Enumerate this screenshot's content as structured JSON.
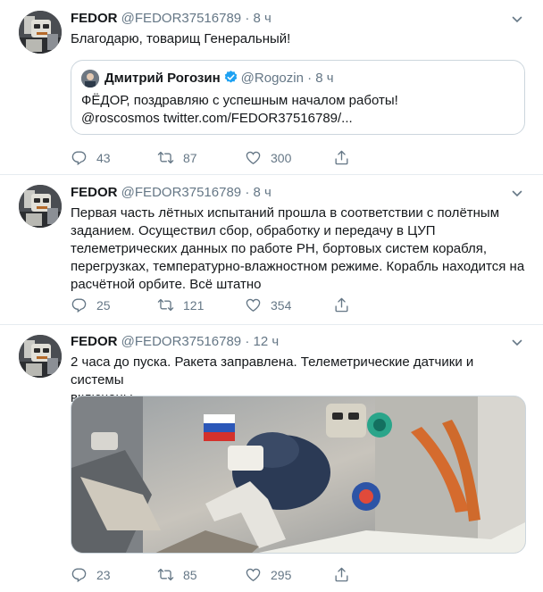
{
  "tweets": [
    {
      "name": "FEDOR",
      "handle": "@FEDOR37516789",
      "dot": "·",
      "time": "8 ч",
      "text": "Благодарю, товарищ Генеральный!",
      "quote": {
        "name": "Дмитрий Рогозин",
        "handle": "@Rogozin",
        "dot": "·",
        "time": "8 ч",
        "line1": "ФЁДОР, поздравляю с успешным началом работы!",
        "line2": "@roscosmos twitter.com/FEDOR37516789/..."
      },
      "replies": "43",
      "retweets": "87",
      "likes": "300"
    },
    {
      "name": "FEDOR",
      "handle": "@FEDOR37516789",
      "dot": "·",
      "time": "8 ч",
      "lines": [
        "Первая часть лётных испытаний прошла в соответствии с полётным",
        "заданием. Осуществил сбор, обработку и передачу в ЦУП",
        "телеметрических данных по работе РН, бортовых систем корабля,",
        "перегрузках, температурно-влажностном режиме. Корабль находится на",
        "расчётной орбите. Всё штатно"
      ],
      "replies": "25",
      "retweets": "121",
      "likes": "354"
    },
    {
      "name": "FEDOR",
      "handle": "@FEDOR37516789",
      "dot": "·",
      "time": "12 ч",
      "lines": [
        "2 часа до пуска. Ракета заправлена. Телеметрические датчики и системы",
        "включены."
      ],
      "replies": "23",
      "retweets": "85",
      "likes": "295"
    }
  ],
  "colors": {
    "text": "#14171a",
    "muted": "#657786",
    "border": "#e6ecf0",
    "verified": "#1da1f2"
  },
  "icons": [
    "reply-icon",
    "retweet-icon",
    "like-icon",
    "share-icon",
    "chevron-down-icon",
    "verified-badge-icon"
  ]
}
